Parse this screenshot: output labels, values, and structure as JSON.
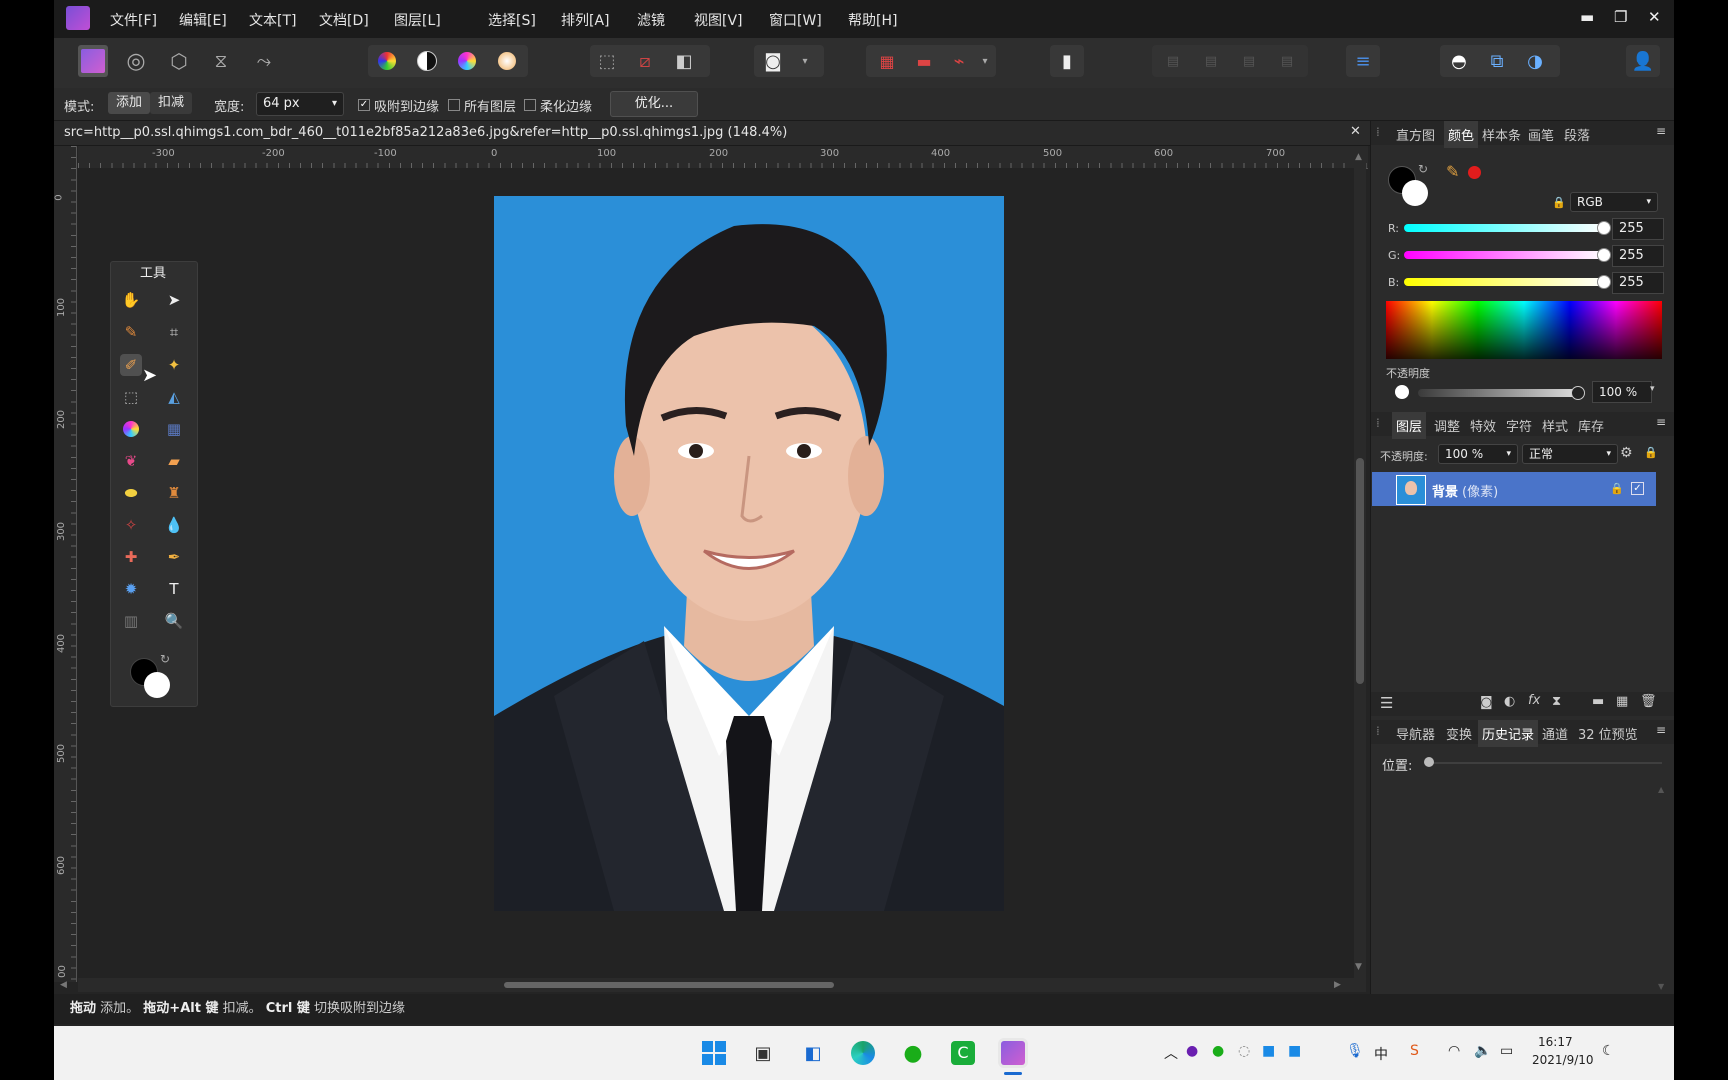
{
  "menu": [
    "文件[F]",
    "编辑[E]",
    "文本[T]",
    "文档[D]",
    "图层[L]",
    "选择[S]",
    "排列[A]",
    "滤镜",
    "视图[V]",
    "窗口[W]",
    "帮助[H]"
  ],
  "context": {
    "mode_label": "模式:",
    "mode_add": "添加",
    "mode_subtract": "扣减",
    "width_label": "宽度:",
    "width_value": "64 px",
    "snap_label": "吸附到边缘",
    "all_layers_label": "所有图层",
    "soft_edge_label": "柔化边缘",
    "refine_label": "优化..."
  },
  "document": {
    "title": "src=http__p0.ssl.qhimgs1.com_bdr_460__t011e2bf85a212a83e6.jpg&refer=http__p0.ssl.qhimgs1.jpg (148.4%)",
    "close": "✕"
  },
  "ruler": {
    "unit": "px",
    "h_ticks": [
      "-300",
      "-200",
      "-100",
      "0",
      "100",
      "200",
      "300",
      "400",
      "500",
      "600",
      "700"
    ],
    "v_ticks": [
      "0",
      "100",
      "200",
      "300",
      "400",
      "500",
      "600",
      "00"
    ]
  },
  "tools_panel": {
    "title": "工具"
  },
  "status": {
    "k1": "拖动",
    "t1": " 添加。",
    "k2": "拖动+Alt 键",
    "t2": " 扣减。",
    "k3": "Ctrl 键",
    "t3": " 切换吸附到边缘"
  },
  "color_panel": {
    "tabs": [
      "直方图",
      "颜色",
      "样本条",
      "画笔",
      "段落"
    ],
    "active_tab": "颜色",
    "model": "RGB",
    "r_label": "R:",
    "r_value": "255",
    "g_label": "G:",
    "g_value": "255",
    "b_label": "B:",
    "b_value": "255",
    "opacity_label": "不透明度",
    "opacity_value": "100 %"
  },
  "layers_panel": {
    "tabs": [
      "图层",
      "调整",
      "特效",
      "字符",
      "样式",
      "库存"
    ],
    "active_tab": "图层",
    "opacity_label": "不透明度:",
    "opacity_value": "100 %",
    "blend_mode": "正常",
    "layer_name": "背景",
    "layer_type": "(像素)"
  },
  "history_panel": {
    "tabs": [
      "导航器",
      "变换",
      "历史记录",
      "通道",
      "32 位预览"
    ],
    "active_tab": "历史记录",
    "position_label": "位置:"
  },
  "taskbar": {
    "time": "16:17",
    "date": "2021/9/10",
    "ime": "中"
  },
  "colors": {
    "accent_blue": "#4a74c9",
    "photo_bg": "#2b8fd8",
    "record_red": "#e21c1c"
  }
}
